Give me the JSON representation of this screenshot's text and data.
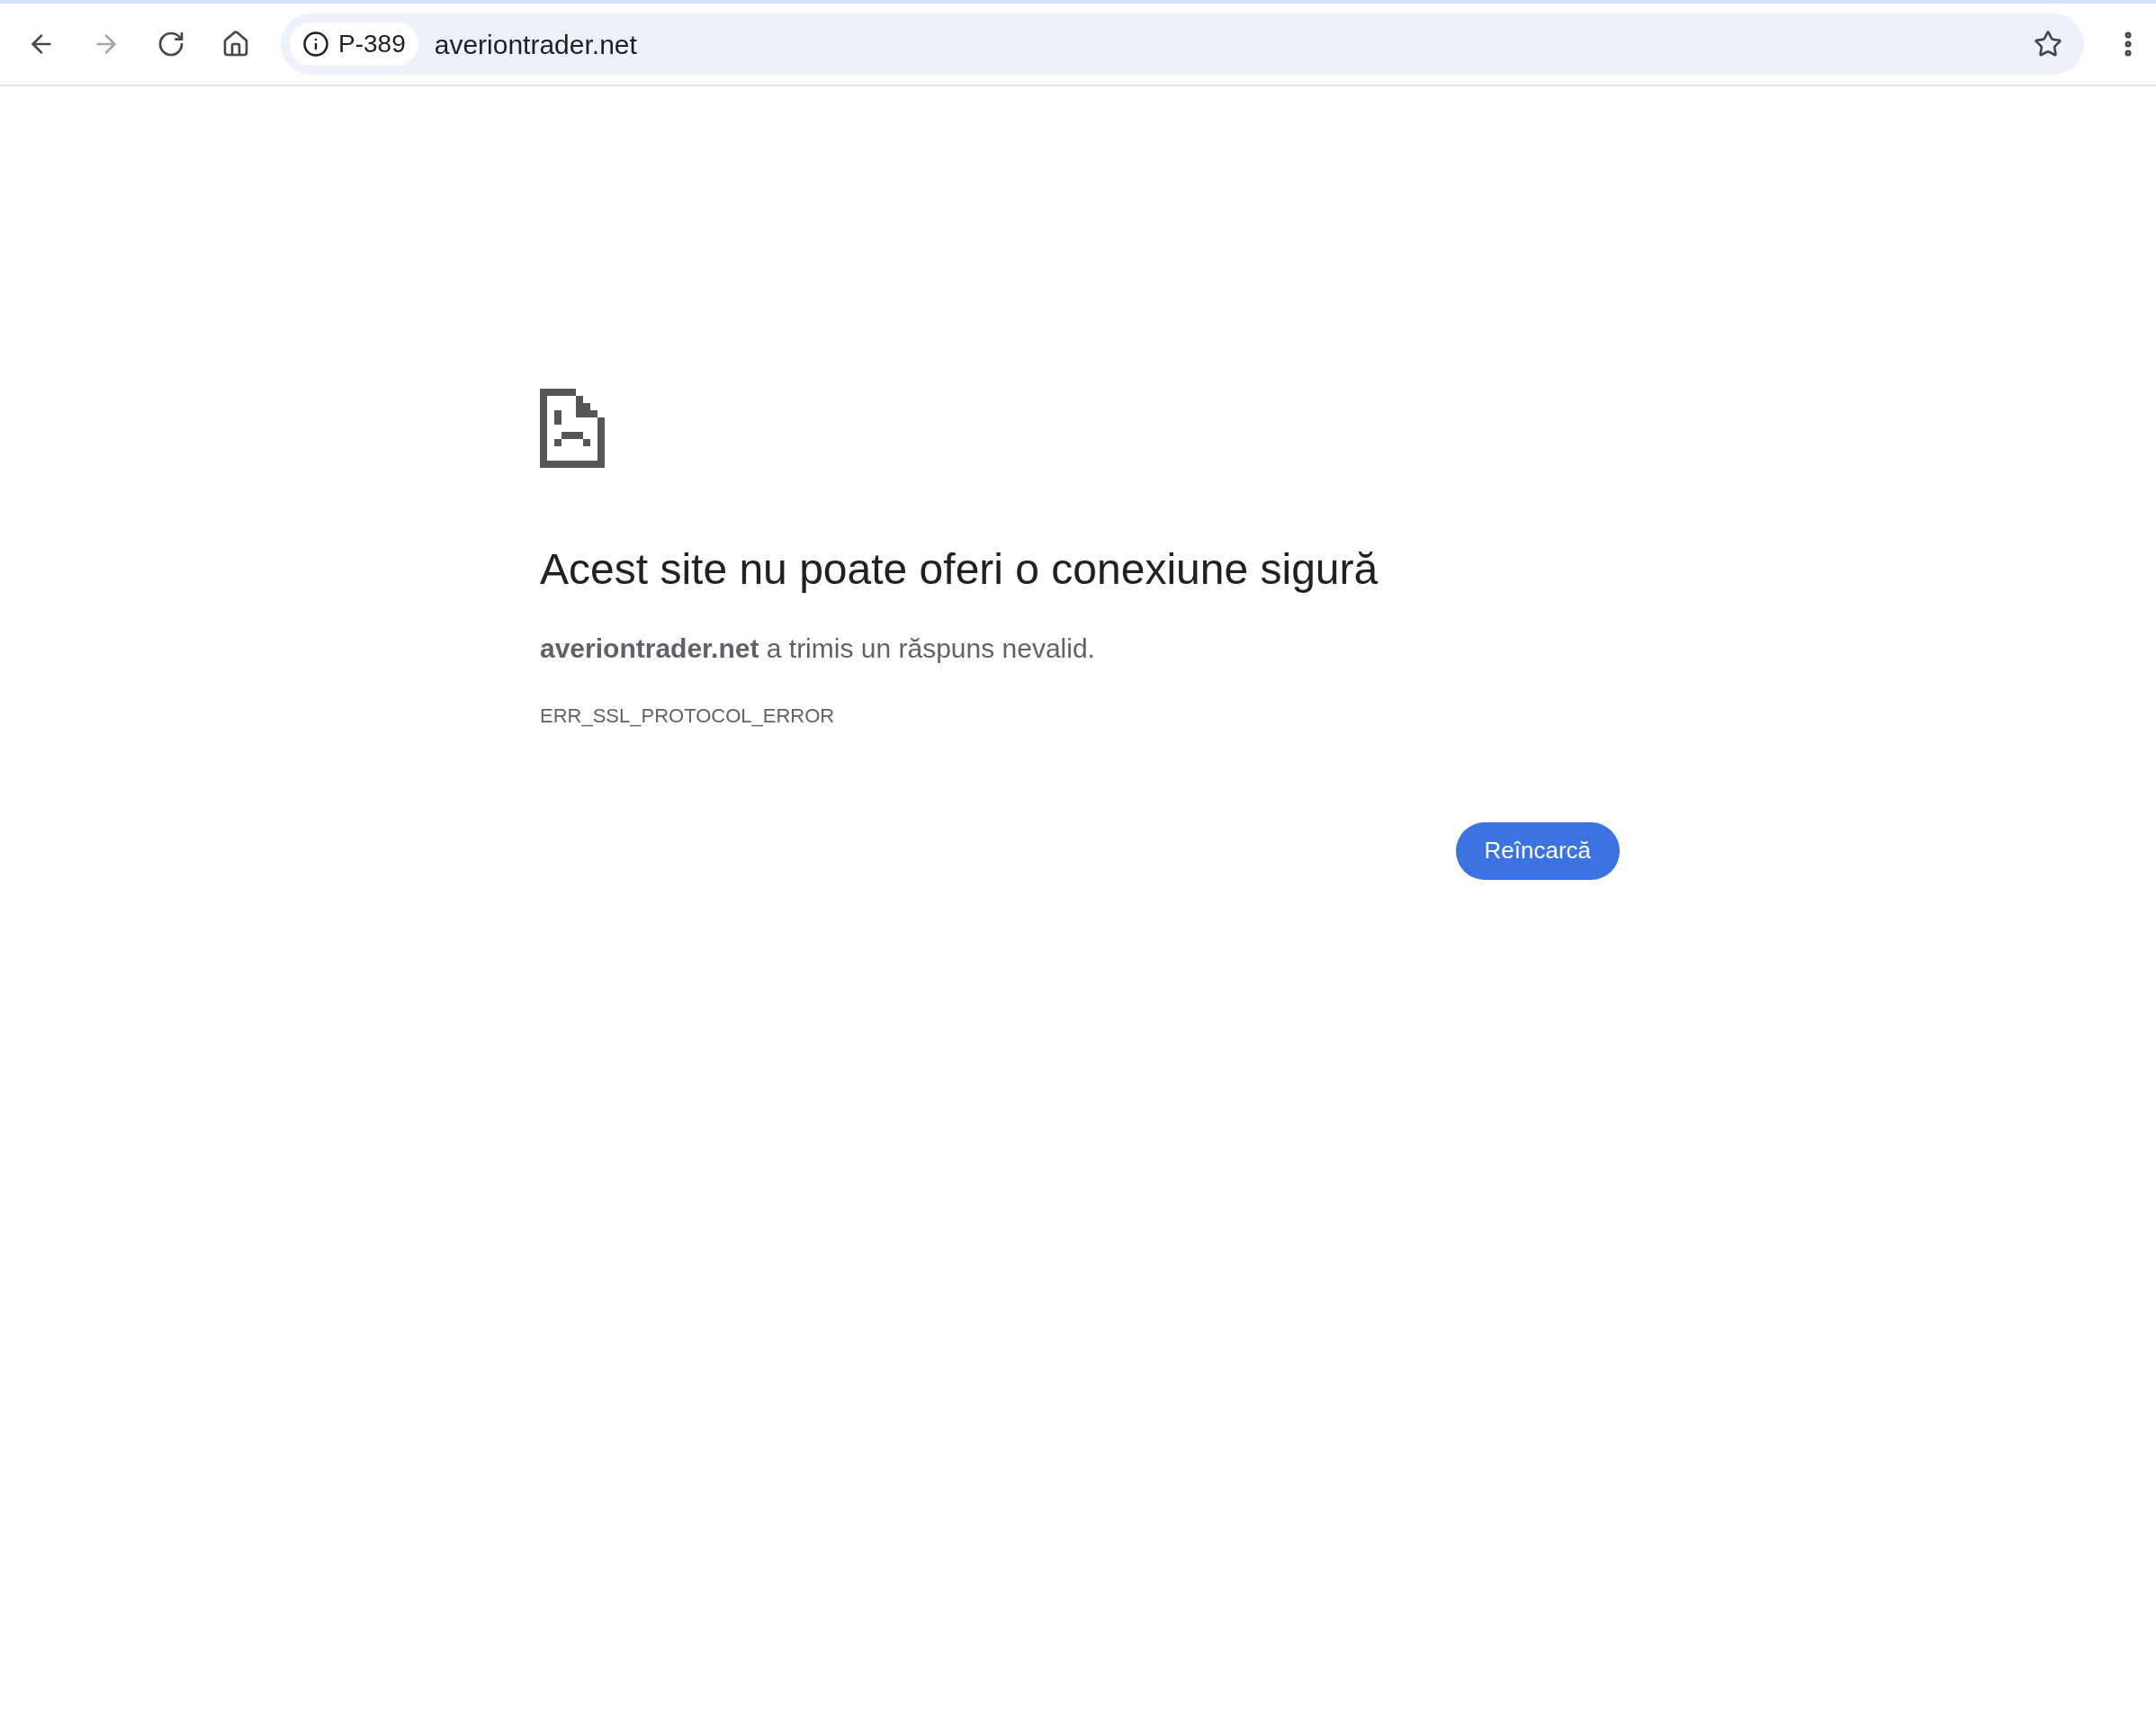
{
  "toolbar": {
    "nav_buttons": [
      {
        "kind": "back",
        "disabled": false
      },
      {
        "kind": "forward",
        "disabled": true
      },
      {
        "kind": "reload",
        "disabled": false
      },
      {
        "kind": "home",
        "disabled": false
      }
    ],
    "address_bar": {
      "security_chip": "P-389",
      "url": "averiontrader.net"
    }
  },
  "error": {
    "title": "Acest site nu poate oferi o conexiune sigură",
    "message": "**averiontrader.net** a trimis un răspuns nevalid.",
    "code": "ERR_SSL_PROTOCOL_ERROR",
    "reload_button": "Reîncarcă"
  }
}
